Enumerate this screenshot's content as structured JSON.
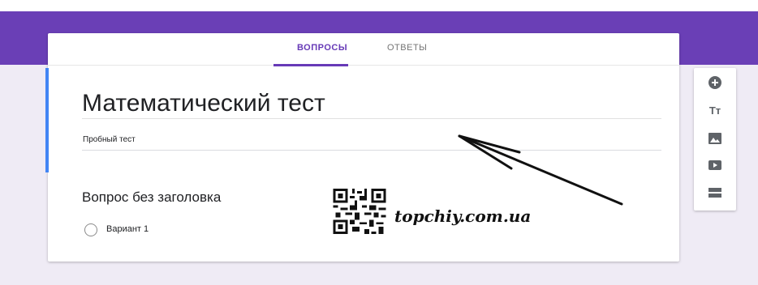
{
  "tabs": {
    "questions": "ВОПРОСЫ",
    "responses": "ОТВЕТЫ"
  },
  "form": {
    "title": "Математический тест",
    "description": "Пробный тест"
  },
  "question": {
    "title": "Вопрос без заголовка",
    "option_label": "Вариант 1"
  },
  "toolbar": {
    "add_question_icon": "add-circle-icon",
    "add_title_icon": "title-text-icon",
    "add_title_glyph": "Tт",
    "add_image_icon": "image-icon",
    "add_video_icon": "video-icon",
    "add_section_icon": "section-icon"
  },
  "watermark": {
    "text": "topchiy.com.ua"
  },
  "colors": {
    "brand": "#673ab7",
    "header_band": "#6a3fb6",
    "background": "#efebf5",
    "focus_bar": "#4285f4"
  }
}
